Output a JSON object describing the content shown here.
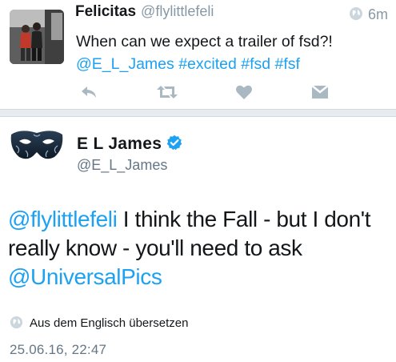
{
  "reply_tweet": {
    "author_name": "Felicitas",
    "author_handle": "@flylittlefeli",
    "time_ago": "6m",
    "text_plain": "When can we expect a trailer of fsd?!",
    "mention": "@E_L_James",
    "hashtags": [
      "#excited",
      "#fsd",
      "#fsf"
    ],
    "actions": [
      "reply-icon",
      "retweet-icon",
      "like-icon",
      "direct-message-icon"
    ]
  },
  "main_tweet": {
    "author_name": "E L James",
    "author_handle": "@E_L_James",
    "verified": true,
    "mention_start": "@flylittlefeli",
    "text_middle": " I think the Fall - but I don't really know - you'll need to ask ",
    "mention_end": "@UniversalPics",
    "translate_label": "Aus dem Englisch übersetzen",
    "timestamp": "25.06.16, 22:47"
  },
  "colors": {
    "link": "#1da1f2",
    "secondary_text": "#8899a6",
    "verified_badge": "#1da1f2",
    "divider": "#e6ecf0"
  }
}
